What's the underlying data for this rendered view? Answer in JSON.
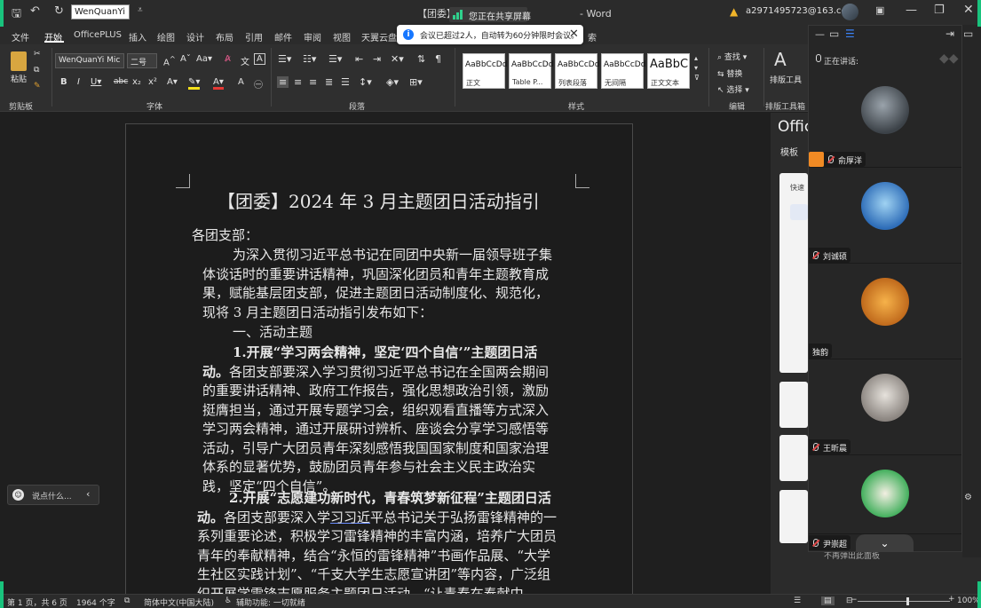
{
  "window": {
    "doc_title": "【团委】",
    "app_name": "- Word",
    "share_banner": "您正在共享屏幕",
    "account": "a2971495723@163.com",
    "font_quick": "WenQuanYi I"
  },
  "tabs": [
    "文件",
    "开始",
    "OfficePLUS",
    "插入",
    "绘图",
    "设计",
    "布局",
    "引用",
    "邮件",
    "审阅",
    "视图",
    "天翼云盘"
  ],
  "tabs_suffix": "索",
  "notice": "会议已超过2人，自动转为60分钟限时会议。",
  "ribbon": {
    "paste": "粘贴",
    "clipboard_label": "剪贴板",
    "font_name": "WenQuanYi Mic",
    "font_size": "二号",
    "font_label": "字体",
    "paragraph_label": "段落",
    "styles_label": "样式",
    "edit_label": "编辑",
    "layout_tool_label": "排版工具箱",
    "find": "查找",
    "replace": "替换",
    "select": "选择",
    "layout_tool": "排版工具",
    "styles": [
      {
        "sample": "AaBbCcDd",
        "name": "正文"
      },
      {
        "sample": "AaBbCcDd",
        "name": "Table P..."
      },
      {
        "sample": "AaBbCcDd",
        "name": "列表段落"
      },
      {
        "sample": "AaBbCcDd",
        "name": "无间隔"
      },
      {
        "sample": "AaBbC",
        "name": "正文文本"
      }
    ]
  },
  "document": {
    "heading": "【团委】2024 年 3 月主题团日活动指引",
    "salutation": "各团支部：",
    "intro": "为深入贯彻习近平总书记在同团中央新一届领导班子集体谈话时的重要讲话精神，巩固深化团员和青年主题教育成果，赋能基层团支部，促进主题团日活动制度化、规范化，现将 3 月主题团日活动指引发布如下：",
    "section1": "一、活动主题",
    "item1_title": "1.开展“学习两会精神，坚定‘四个自信’”主题团日活动。",
    "item1_body": "各团支部要深入学习贯彻习近平总书记在全国两会期间的重要讲话精神、政府工作报告，强化思想政治引领，激励挺膺担当，通过开展专题学习会，组织观看直播等方式深入学习两会精神，通过开展研讨辨析、座谈会分享学习感悟等活动，引导广大团员青年深刻感悟我国国家制度和国家治理体系的显著优势，鼓励团员青年参与社会主义民主政治实践，坚定“四个自信”。",
    "item2_title": "2.开展“志愿建功新时代，青春筑梦新征程”主题团日活动。",
    "item2_body_a": "各团支部要深入学",
    "item2_body_u": "习习近",
    "item2_body_b": "平总书记关于弘扬雷锋精神的一系列重要论述，积极学习雷锋精神的丰富内涵，培养广大团员青年的奉献精神，结合“永恒的雷锋精神”书画作品展、“大学生社区实践计划”、“千支大学生志愿宣讲团”等内容，广泛组织开展学雷锋志愿服务主题团日活动，“让青春在奉献中"
  },
  "chat": {
    "placeholder": "说点什么..."
  },
  "office_panel": {
    "title": "Office",
    "tab": "模板",
    "quick": "快速",
    "footer": "不再弹出此面板"
  },
  "meeting": {
    "speaking_label": "正在讲话:",
    "participants": [
      {
        "name": "俞厚洋"
      },
      {
        "name": "刘诚硕"
      },
      {
        "name": "独韵"
      },
      {
        "name": "王昕晨"
      },
      {
        "name": "尹崇超"
      }
    ]
  },
  "status": {
    "page": "第 1 页，共 6 页",
    "words": "1964 个字",
    "lang": "简体中文(中国大陆)",
    "access": "辅助功能: 一切就绪",
    "zoom": "100%"
  },
  "colors": {
    "accent_green": "#19c37d",
    "host_orange": "#f08a24",
    "notice_blue": "#1677ff"
  }
}
